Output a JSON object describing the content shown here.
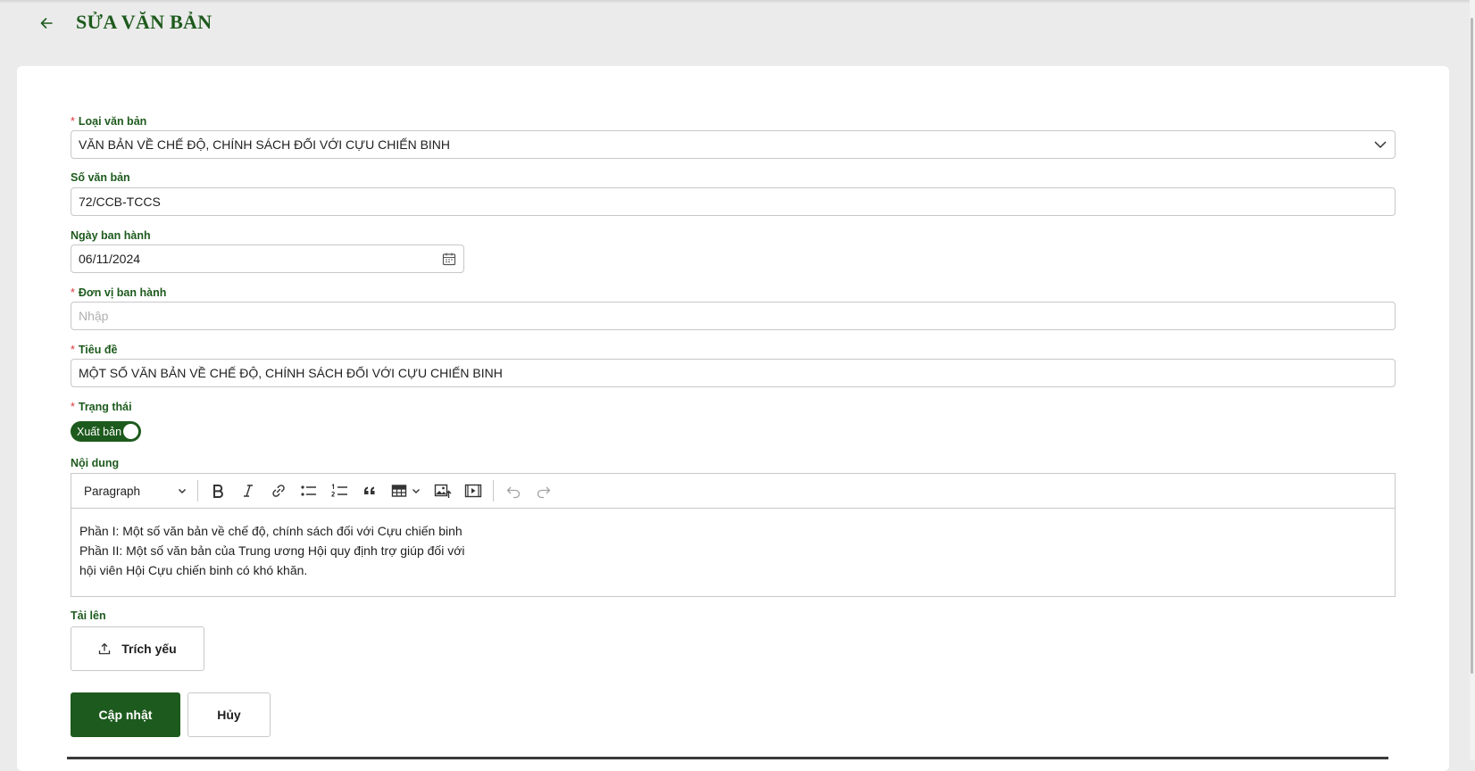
{
  "header": {
    "title": "SỬA VĂN BẢN"
  },
  "form": {
    "doc_type": {
      "label": "Loại văn bản",
      "required_mark": "*",
      "value": "VĂN BẢN VỀ CHẾ ĐỘ, CHÍNH SÁCH ĐỐI VỚI CỰU CHIẾN BINH"
    },
    "doc_number": {
      "label": "Số văn bản",
      "value": "72/CCB-TCCS"
    },
    "issue_date": {
      "label": "Ngày ban hành",
      "value": "06/11/2024"
    },
    "issuer": {
      "label": "Đơn vị ban hành",
      "required_mark": "*",
      "placeholder": "Nhập"
    },
    "title": {
      "label": "Tiêu đề",
      "required_mark": "*",
      "value": "MỘT SỐ VĂN BẢN VỀ CHẾ ĐỘ, CHÍNH SÁCH ĐỐI VỚI CỰU CHIẾN BINH"
    },
    "status": {
      "label": "Trạng thái",
      "required_mark": "*",
      "toggle_label": "Xuất bản",
      "checked": true
    },
    "content": {
      "label": "Nội dung",
      "paragraph_select": "Paragraph",
      "lines": [
        "Phần I: Một số văn bản về chế độ, chính sách đối với Cựu chiến binh",
        "Phần II: Một số văn bản của Trung ương Hội quy định trợ giúp đối với",
        "hội viên Hội Cựu chiến binh có khó khăn."
      ]
    },
    "upload": {
      "label": "Tải lên",
      "button_label": "Trích yếu"
    }
  },
  "actions": {
    "submit_label": "Cập nhật",
    "cancel_label": "Hủy"
  },
  "colors": {
    "primary": "#1d5a1d",
    "required": "#d9363e",
    "border": "#c8c8c8",
    "background": "#ebebeb"
  },
  "icons": [
    "arrow-left-icon",
    "chevron-down-icon",
    "calendar-icon",
    "bold-icon",
    "italic-icon",
    "link-icon",
    "bulleted-list-icon",
    "numbered-list-icon",
    "blockquote-icon",
    "table-icon",
    "image-upload-icon",
    "media-embed-icon",
    "undo-icon",
    "redo-icon",
    "upload-icon"
  ]
}
